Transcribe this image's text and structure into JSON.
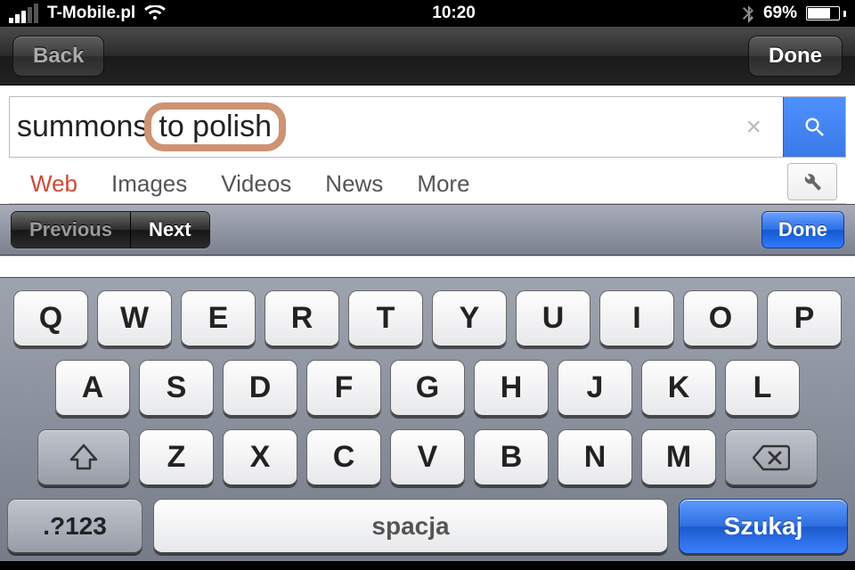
{
  "status": {
    "carrier": "T-Mobile.pl",
    "time": "10:20",
    "battery_pct": "69%"
  },
  "nav": {
    "back": "Back",
    "done": "Done"
  },
  "search": {
    "query_prefix": "summons",
    "query_highlight": "to polish"
  },
  "tabs": {
    "web": "Web",
    "images": "Images",
    "videos": "Videos",
    "news": "News",
    "more": "More"
  },
  "form_assistant": {
    "previous": "Previous",
    "next": "Next",
    "done": "Done"
  },
  "keyboard": {
    "row1": [
      "Q",
      "W",
      "E",
      "R",
      "T",
      "Y",
      "U",
      "I",
      "O",
      "P"
    ],
    "row2": [
      "A",
      "S",
      "D",
      "F",
      "G",
      "H",
      "J",
      "K",
      "L"
    ],
    "row3": [
      "Z",
      "X",
      "C",
      "V",
      "B",
      "N",
      "M"
    ],
    "mode": ".?123",
    "space": "spacja",
    "action": "Szukaj"
  }
}
